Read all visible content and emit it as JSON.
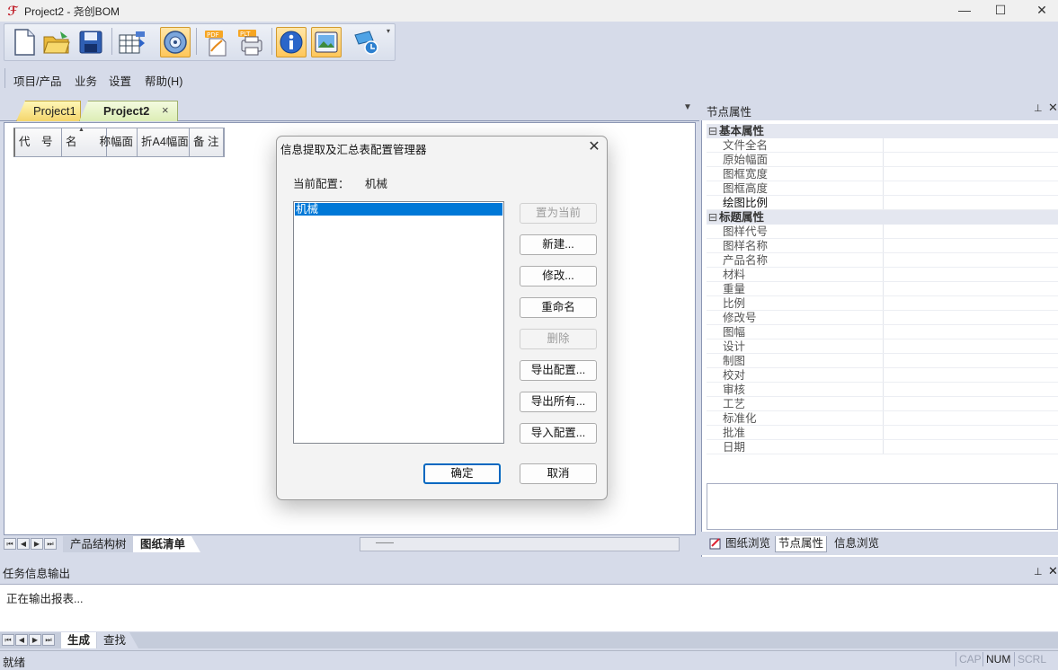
{
  "window": {
    "title": "Project2 - 尧创BOM",
    "logo_glyph": "ℱ",
    "minimize": "—",
    "maximize": "☐",
    "close": "✕"
  },
  "toolbar": {
    "items": [
      {
        "icon": "new-document-icon"
      },
      {
        "icon": "open-folder-icon"
      },
      {
        "icon": "save-icon"
      },
      {
        "icon": "table-export-icon"
      },
      {
        "icon": "config-disc-icon",
        "active": true
      },
      {
        "icon": "pdf-icon",
        "label": "PDF"
      },
      {
        "icon": "plt-print-icon",
        "label": "PLT"
      },
      {
        "icon": "info-icon",
        "active": true
      },
      {
        "icon": "image-viewer-icon",
        "active": true
      },
      {
        "icon": "update-icon"
      }
    ],
    "overflow": "▾"
  },
  "menu": {
    "items": [
      "项目/产品",
      "业务",
      "设置",
      "帮助(H)"
    ]
  },
  "doc_tabs": {
    "tab1": "Project1",
    "tab2": "Project2",
    "close": "×",
    "dropdown": "▼"
  },
  "grid": {
    "columns": [
      "代　号",
      "名　　称",
      "幅面",
      "折A4幅面",
      "备 注"
    ],
    "sort_indicator": "▲"
  },
  "sheet_tabs": {
    "nav": [
      "⏮",
      "◀",
      "▶",
      "⏭"
    ],
    "tab_tree": "产品结构树",
    "tab_list": "图纸清单",
    "scroll_thumb": "——"
  },
  "right_panel": {
    "title": "节点属性",
    "pin": "⊥",
    "close": "✕",
    "categories": [
      {
        "label": "基本属性",
        "expander": "⊟",
        "rows": [
          "文件全名",
          "原始幅面",
          "图框宽度",
          "图框高度",
          "绘图比例"
        ],
        "strong_index": 4
      },
      {
        "label": "标题属性",
        "expander": "⊟",
        "rows": [
          "图样代号",
          "图样名称",
          "产品名称",
          "材料",
          "重量",
          "比例",
          "修改号",
          "图幅",
          "设计",
          "制图",
          "校对",
          "审核",
          "工艺",
          "标准化",
          "批准",
          "日期"
        ]
      }
    ],
    "bottom_tabs": [
      "图纸浏览",
      "节点属性",
      "信息浏览"
    ]
  },
  "task_output": {
    "title": "任务信息输出",
    "pin": "⊥",
    "close": "✕",
    "message": "正在输出报表...",
    "tab_gen": "生成",
    "tab_find": "查找"
  },
  "status": {
    "text": "就绪",
    "cap": "CAP",
    "num": "NUM",
    "scrl": "SCRL"
  },
  "dialog": {
    "title": "信息提取及汇总表配置管理器",
    "close": "✕",
    "current_label": "当前配置：",
    "current_value": "机械",
    "list_items": [
      "机械"
    ],
    "buttons": {
      "set_current": "置为当前",
      "new": "新建...",
      "modify": "修改...",
      "rename": "重命名",
      "delete": "删除",
      "export": "导出配置...",
      "export_all": "导出所有...",
      "import": "导入配置..."
    },
    "ok": "确定",
    "cancel": "取消"
  }
}
